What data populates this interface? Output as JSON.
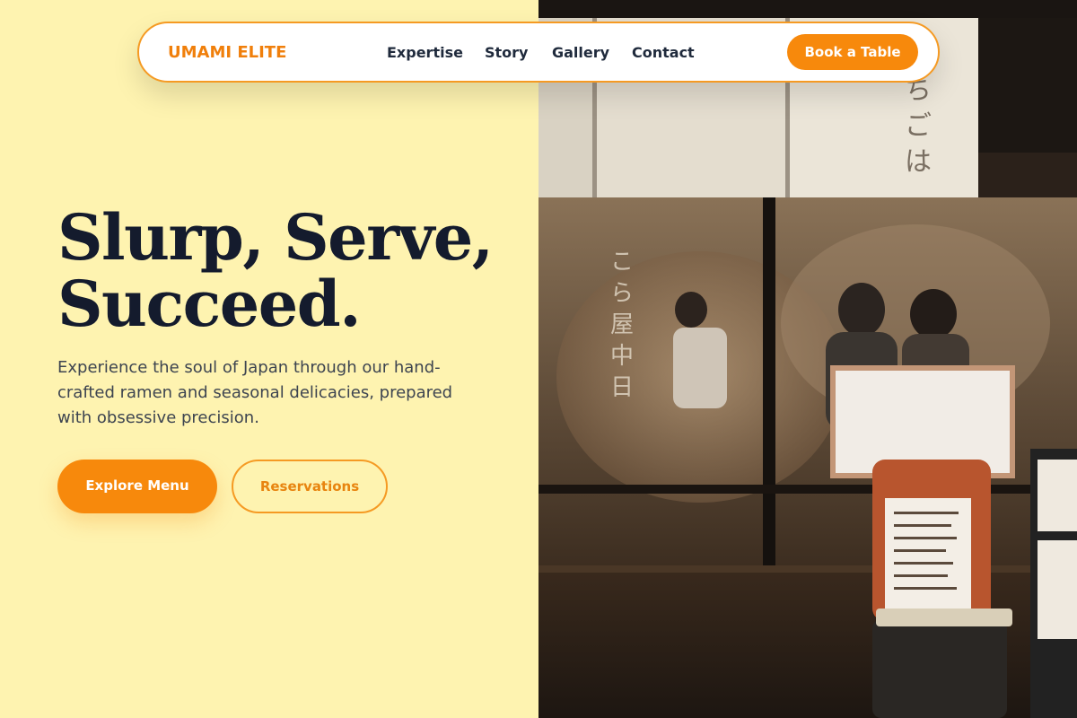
{
  "brand": {
    "name": "UMAMI ELITE"
  },
  "nav": {
    "links": [
      "Expertise",
      "Story",
      "Gallery",
      "Contact"
    ],
    "cta": "Book a Table"
  },
  "hero": {
    "title_line1": "Slurp, Serve,",
    "title_line2": "Succeed.",
    "subtitle": "Experience the soul of Japan through our hand-crafted ramen and seasonal delicacies, prepared with obsessive precision.",
    "primary_button": "Explore Menu",
    "secondary_button": "Reservations"
  },
  "photo": {
    "subject": "ramen-shop-storefront-photo"
  },
  "colors": {
    "background": "#fef3b0",
    "accent": "#f7890c",
    "heading": "#141b2d",
    "body_text": "#3d4450"
  }
}
